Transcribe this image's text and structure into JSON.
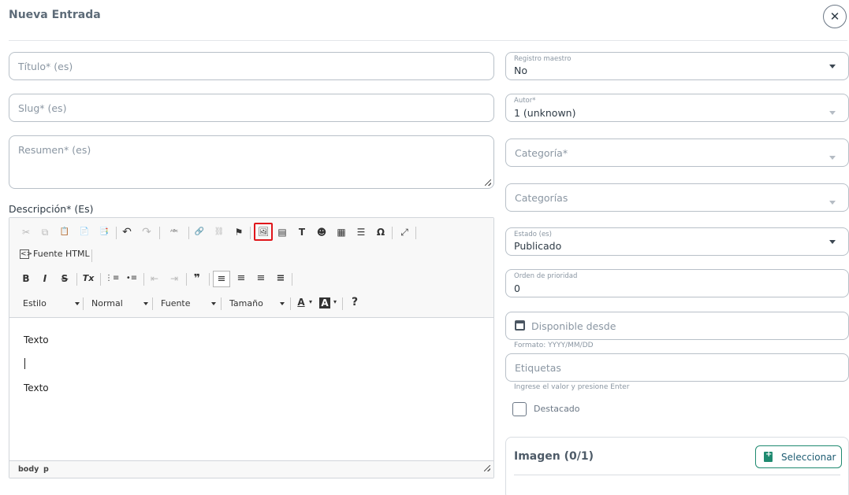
{
  "header": {
    "title": "Nueva Entrada",
    "close_symbol": "✕"
  },
  "form": {
    "titulo_placeholder": "Título* (es)",
    "slug_placeholder": "Slug* (es)",
    "resumen_placeholder": "Resumen* (es)",
    "descripcion_label": "Descripción* (Es)"
  },
  "editor": {
    "source_label": "Fuente HTML",
    "combos": {
      "estilo": "Estilo",
      "formato": "Normal",
      "fuente": "Fuente",
      "tamano": "Tamaño"
    },
    "content_lines": [
      "Texto",
      "Texto"
    ],
    "status_path": [
      "body",
      "p"
    ],
    "icons": {
      "cut": "✂",
      "copy": "⧉",
      "paste": "📋",
      "paste_text": "📄",
      "paste_word": "📑",
      "undo": "↶",
      "redo": "↷",
      "spellcheck": "ᴬᴮᶜ",
      "link": "🔗",
      "unlink": "⛓",
      "anchor": "⚑",
      "image": "🖼",
      "iframe": "▤",
      "template": "T",
      "smiley": "☻",
      "table": "▦",
      "hr": "☰",
      "special_char": "Ω",
      "maximize": "⤢",
      "bold": "B",
      "italic": "I",
      "strike": "S",
      "remove_format": "Tx",
      "numbered_list": "⋮≡",
      "bulleted_list": "•≡",
      "outdent": "⇤",
      "indent": "⇥",
      "blockquote": "❞",
      "align_left": "≡",
      "align_center": "≡",
      "align_right": "≡",
      "justify": "≡",
      "text_color": "A",
      "bg_color": "A",
      "help": "?"
    }
  },
  "sidebar": {
    "registro_label": "Registro maestro",
    "registro_value": "No",
    "autor_label": "Autor*",
    "autor_value": "1 (unknown)",
    "categoria_placeholder": "Categoría*",
    "categorias_placeholder": "Categorías",
    "estado_label": "Estado (es)",
    "estado_value": "Publicado",
    "orden_label": "Orden de prioridad",
    "orden_value": "0",
    "disponible_placeholder": "Disponible desde",
    "disponible_hint": "Formato: YYYY/MM/DD",
    "etiquetas_placeholder": "Etiquetas",
    "etiquetas_hint": "Ingrese el valor y presione Enter",
    "destacado_label": "Destacado"
  },
  "image_card": {
    "title": "Imagen (0/1)",
    "select_label": "Seleccionar"
  },
  "colors": {
    "highlight": "#e0161b",
    "accent": "#1f8a70"
  }
}
